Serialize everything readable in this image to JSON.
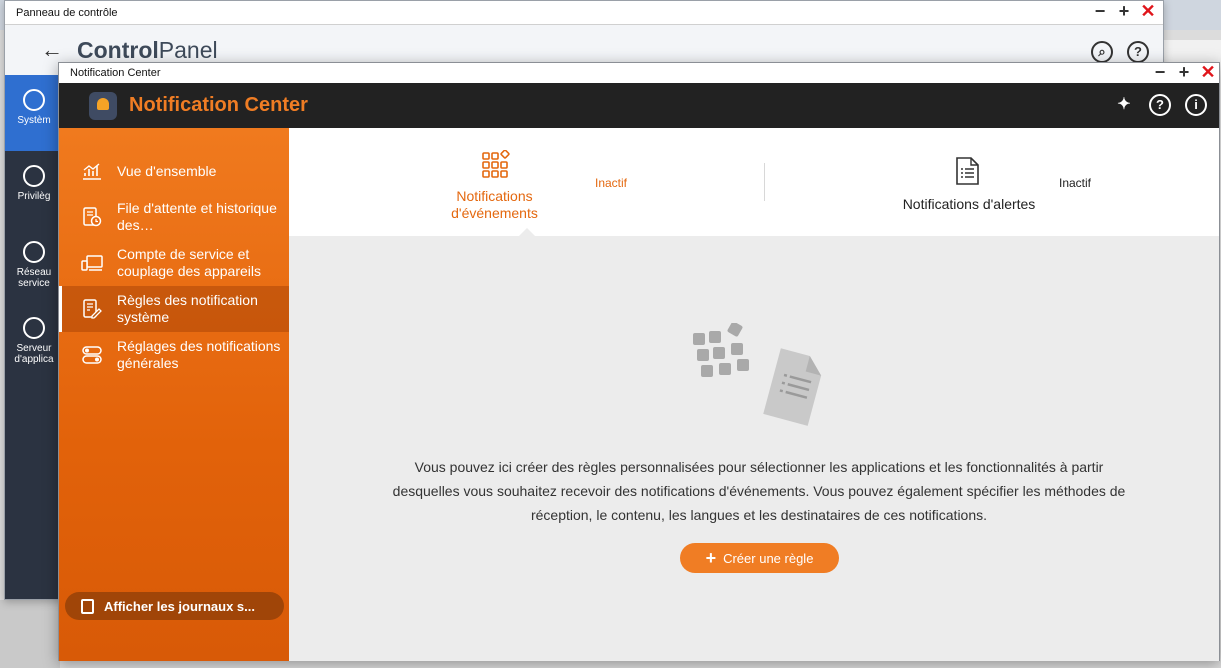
{
  "control_panel": {
    "window_title": "Panneau de contrôle",
    "brand_bold": "Control",
    "brand_light": "Panel",
    "sidebar": [
      {
        "label": "Systèm",
        "icon": "gear-icon"
      },
      {
        "label": "Privilèg",
        "icon": "user-icon"
      },
      {
        "label": "Réseau service",
        "icon": "globe-icon"
      },
      {
        "label": "Serveur d'applica",
        "icon": "grid-icon"
      }
    ]
  },
  "notification_center": {
    "window_title": "Notification Center",
    "app_name": "Notification Center",
    "nav": [
      {
        "label": "Vue d'ensemble",
        "icon": "chart-icon"
      },
      {
        "label": "File d'attente et historique des…",
        "icon": "queue-history-icon"
      },
      {
        "label": "Compte de service et couplage des appareils",
        "icon": "devices-icon"
      },
      {
        "label": "Règles des notification système",
        "icon": "rules-edit-icon",
        "active": true
      },
      {
        "label": "Réglages des notifications générales",
        "icon": "toggles-icon"
      }
    ],
    "logs_button": "Afficher les journaux s...",
    "tabs": {
      "event": {
        "label": "Notifications d'événements",
        "status": "Inactif",
        "icon": "event-grid-icon"
      },
      "alert": {
        "label": "Notifications d'alertes",
        "status": "Inactif",
        "icon": "document-icon"
      }
    },
    "empty_text": "Vous pouvez ici créer des règles personnalisées pour sélectionner les applications et les fonctionnalités à partir desquelles vous souhaitez recevoir des notifications d'événements. Vous pouvez également spécifier les méthodes de réception, le contenu, les langues et les destinataires de ces notifications.",
    "create_button": "Créer une règle"
  },
  "colors": {
    "accent": "#f07d24",
    "sidebar_orange": "#e2620a",
    "header_dark": "#222222",
    "close_red": "#e0151b"
  }
}
